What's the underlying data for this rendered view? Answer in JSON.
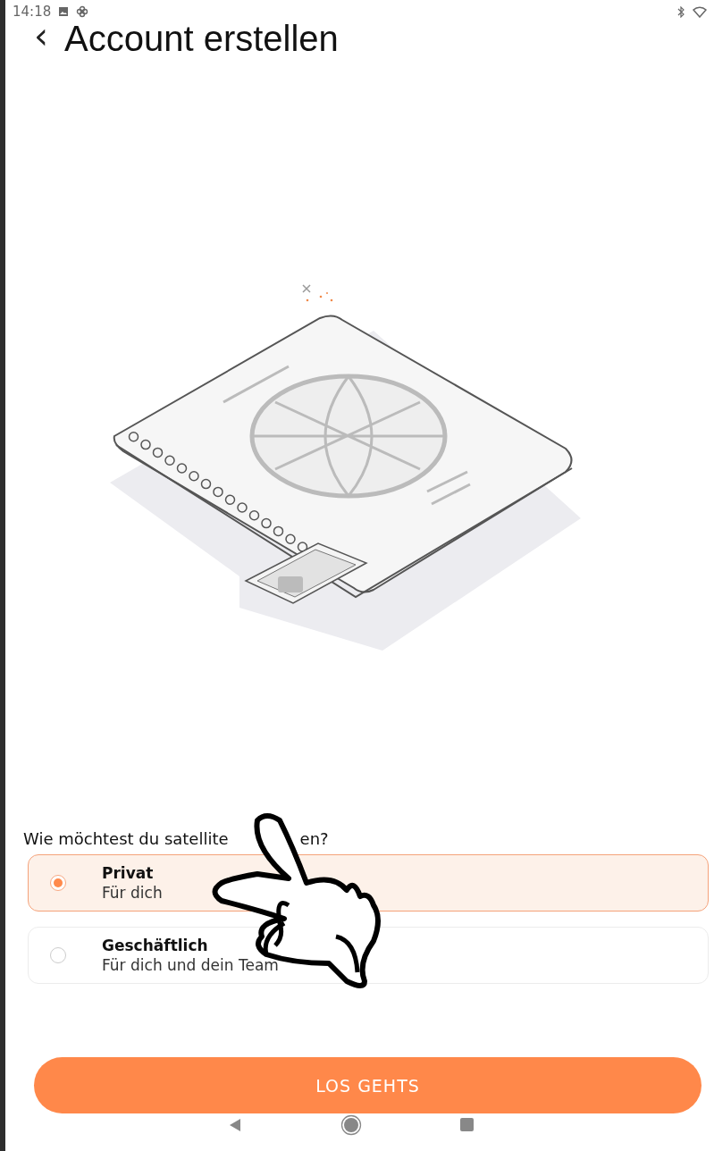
{
  "status_bar": {
    "time": "14:18"
  },
  "header": {
    "back": "‹",
    "title": "Account erstellen"
  },
  "question": {
    "parts": [
      "Wie möchtest du satellite",
      "en?"
    ]
  },
  "options": [
    {
      "title": "Privat",
      "subtitle": "Für dich",
      "selected": true
    },
    {
      "title": "Geschäftlich",
      "subtitle": "Für dich und dein Team",
      "selected": false
    }
  ],
  "button": "LOS GEHTS"
}
